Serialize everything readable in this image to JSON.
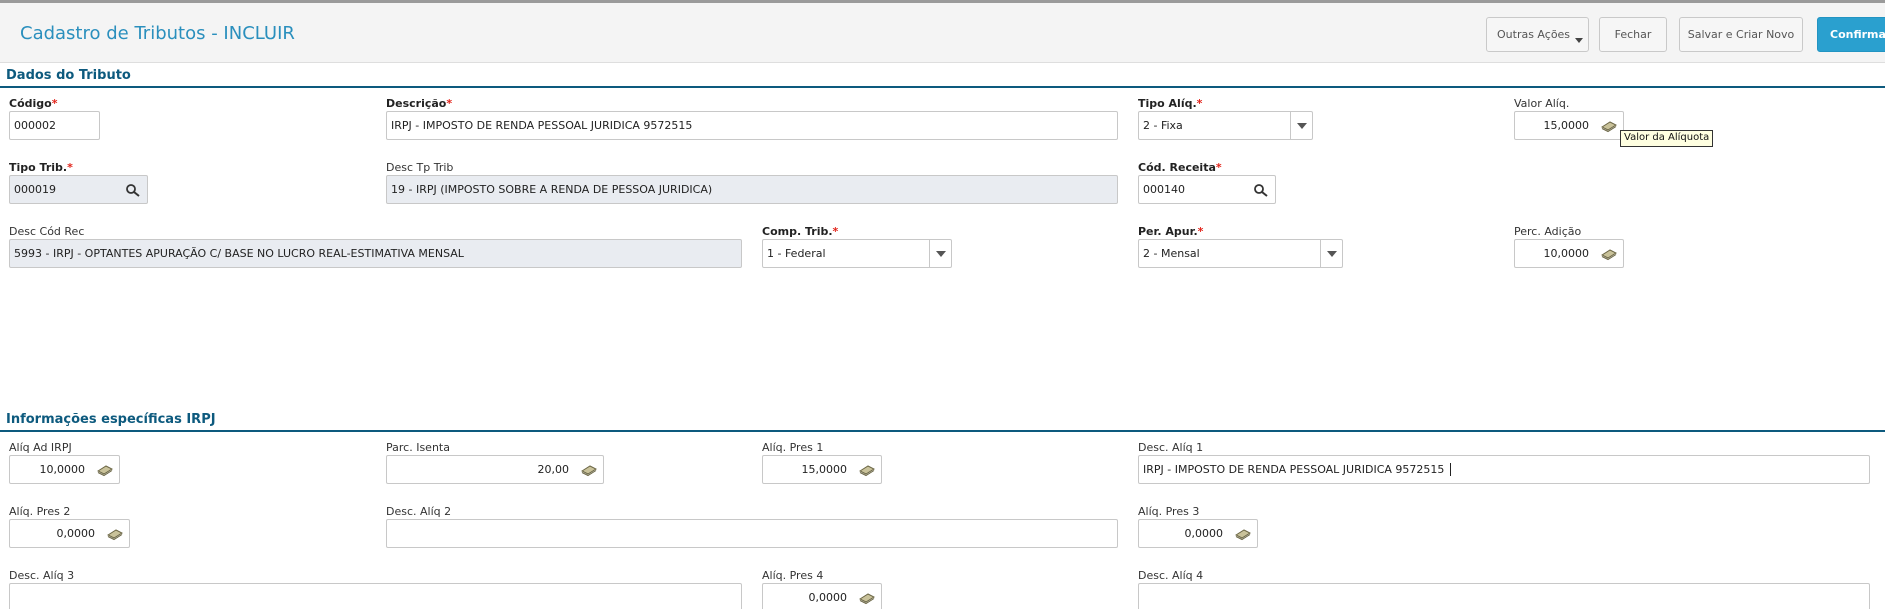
{
  "page": {
    "title": "Cadastro de Tributos - INCLUIR"
  },
  "toolbar": {
    "more_actions_label": "Outras Ações",
    "close_label": "Fechar",
    "save_new_label": "Salvar e Criar Novo",
    "confirm_label": "Confirmar"
  },
  "colors": {
    "accent": "#2aa0cf",
    "section": "#0d5a7e",
    "required_star": "#e2231a",
    "readonly_bg": "#e9ecf1"
  },
  "icons": {
    "search": "search-icon",
    "money": "money-icon",
    "dropdown": "chevron-down-icon"
  },
  "section1": {
    "title": "Dados do Tributo",
    "codigo": {
      "label": "Código",
      "value": "000002"
    },
    "descricao": {
      "label": "Descrição",
      "value": "IRPJ - IMPOSTO DE RENDA PESSOAL JURIDICA 9572515"
    },
    "tipo_aliq": {
      "label": "Tipo Alíq.",
      "value": "2 - Fixa"
    },
    "valor_aliq": {
      "label": "Valor Alíq.",
      "value": "15,0000",
      "tooltip": "Valor da Alíquota"
    },
    "tipo_trib": {
      "label": "Tipo Trib.",
      "value": "000019"
    },
    "desc_tp_trib": {
      "label": "Desc Tp Trib",
      "value": "19 - IRPJ (IMPOSTO SOBRE A RENDA DE PESSOA JURIDICA)"
    },
    "cod_receita": {
      "label": "Cód. Receita",
      "value": "000140"
    },
    "desc_cod_rec": {
      "label": "Desc Cód Rec",
      "value": "5993 - IRPJ - OPTANTES APURAÇÃO C/ BASE NO LUCRO REAL-ESTIMATIVA MENSAL"
    },
    "comp_trib": {
      "label": "Comp. Trib.",
      "value": "1 - Federal"
    },
    "per_apur": {
      "label": "Per. Apur.",
      "value": "2 - Mensal"
    },
    "perc_adicao": {
      "label": "Perc. Adição",
      "value": "10,0000"
    }
  },
  "section2": {
    "title": "Informações específicas IRPJ",
    "aliq_ad_irpj": {
      "label": "Alíq Ad IRPJ",
      "value": "10,0000"
    },
    "parc_isenta": {
      "label": "Parc. Isenta",
      "value": "20,00"
    },
    "aliq_pres1": {
      "label": "Alíq. Pres 1",
      "value": "15,0000"
    },
    "desc_aliq1": {
      "label": "Desc. Alíq 1",
      "value": "IRPJ - IMPOSTO DE RENDA PESSOAL JURIDICA 9572515"
    },
    "aliq_pres2": {
      "label": "Alíq. Pres 2",
      "value": "0,0000"
    },
    "desc_aliq2": {
      "label": "Desc. Alíq 2",
      "value": ""
    },
    "aliq_pres3": {
      "label": "Alíq. Pres 3",
      "value": "0,0000"
    },
    "desc_aliq3": {
      "label": "Desc. Alíq 3",
      "value": ""
    },
    "aliq_pres4": {
      "label": "Alíq. Pres 4",
      "value": "0,0000"
    },
    "desc_aliq4": {
      "label": "Desc. Alíq 4",
      "value": ""
    }
  }
}
